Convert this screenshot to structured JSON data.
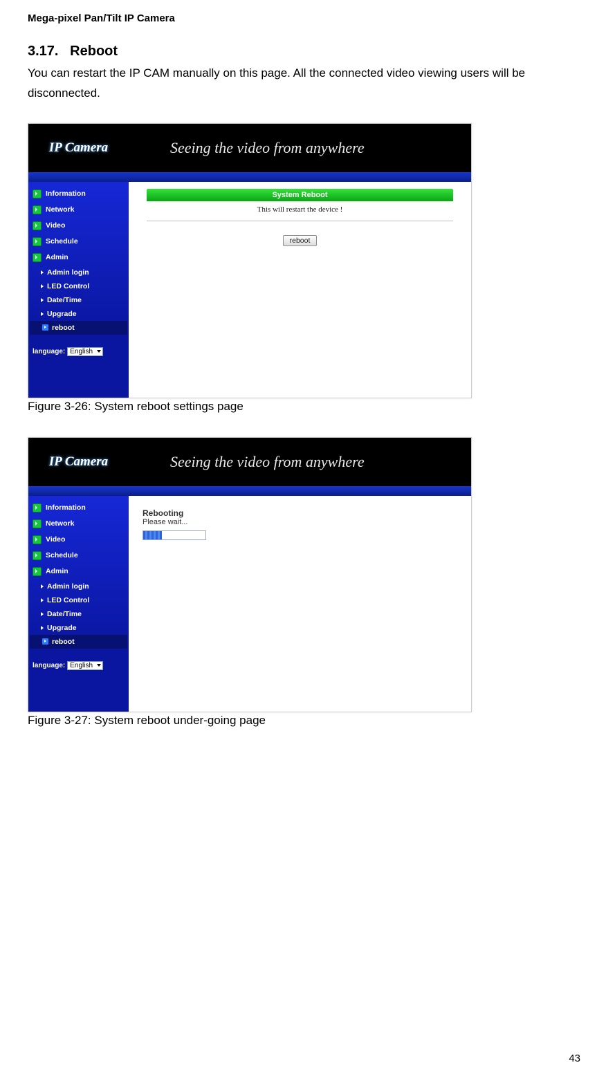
{
  "doc": {
    "header": "Mega-pixel Pan/Tilt IP Camera",
    "section_number": "3.17.",
    "section_title": "Reboot",
    "intro": "You can restart the IP CAM manually on this page. All the connected video viewing users will be disconnected.",
    "caption1": "Figure 3-26: System reboot settings page",
    "caption2": "Figure 3-27: System reboot under-going page",
    "page_number": "43"
  },
  "shot": {
    "logo": "IP Camera",
    "slogan": "Seeing the video from anywhere",
    "nav": {
      "information": "Information",
      "network": "Network",
      "video": "Video",
      "schedule": "Schedule",
      "admin": "Admin",
      "admin_login": "Admin login",
      "led_control": "LED Control",
      "date_time": "Date/Time",
      "upgrade": "Upgrade",
      "reboot": "reboot"
    },
    "lang_label": "language:",
    "lang_value": "English",
    "panel1": {
      "title": "System Reboot",
      "message": "This will restart the device !",
      "button": "reboot"
    },
    "panel2": {
      "title": "Rebooting",
      "message": "Please wait..."
    }
  }
}
